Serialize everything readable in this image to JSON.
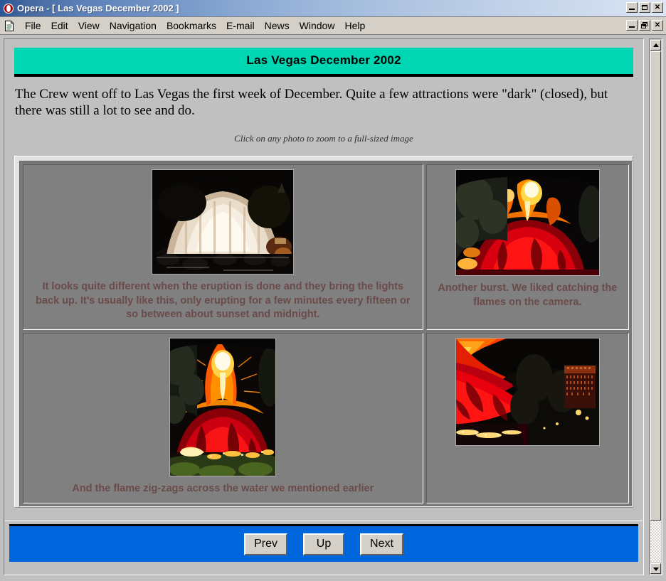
{
  "window": {
    "title": "Opera - [ Las Vegas December 2002 ]",
    "logo_icon": "opera-logo-icon",
    "buttons": {
      "minimize": "minimize-button",
      "maximize": "maximize-button",
      "close": "close-button",
      "mdi_minimize": "mdi-minimize-button",
      "mdi_restore": "mdi-restore-button",
      "mdi_close": "mdi-close-button"
    }
  },
  "menubar": {
    "doc_icon": "document-icon",
    "items": [
      {
        "label": "File"
      },
      {
        "label": "Edit"
      },
      {
        "label": "View"
      },
      {
        "label": "Navigation"
      },
      {
        "label": "Bookmarks"
      },
      {
        "label": "E-mail"
      },
      {
        "label": "News"
      },
      {
        "label": "Window"
      },
      {
        "label": "Help"
      }
    ]
  },
  "page": {
    "header_title": "Las Vegas December 2002",
    "header_background": "#00d6b2",
    "intro": "The Crew went off to Las Vegas the first week of December. Quite a few attractions were \"dark\" (closed), but there was still a lot to see and do.",
    "click_note": "Click on any photo to zoom to a full-sized image",
    "caption_color": "#6b4a4a",
    "cells": [
      {
        "photo_name": "photo-volcano-lights-up",
        "photo_alt": "Waterfall mound lit up white at night after the eruption",
        "caption": "It looks quite different when the eruption is done and they bring the lights back up. It's usually like this, only erupting for a few minutes every fifteen or so between about sunset and midnight."
      },
      {
        "photo_name": "photo-volcano-burst",
        "photo_alt": "Erupting volcano with red lava and a bright orange flame burst",
        "caption": "Another burst. We liked catching the flames on the camera."
      },
      {
        "photo_name": "photo-volcano-tall-flame",
        "photo_alt": "Tall flame column rising above the glowing red volcano",
        "caption": "And the flame zig-zags across the water we mentioned earlier"
      },
      {
        "photo_name": "photo-volcano-with-hotel",
        "photo_alt": "Red glowing volcano with a lit hotel tower in the background",
        "caption": ""
      }
    ]
  },
  "navbar": {
    "background": "#0066dd",
    "buttons": [
      {
        "label": "Prev",
        "name": "prev-button"
      },
      {
        "label": "Up",
        "name": "up-button"
      },
      {
        "label": "Next",
        "name": "next-button"
      }
    ]
  },
  "scrollbar": {
    "up_icon": "scroll-up-arrow-icon",
    "down_icon": "scroll-down-arrow-icon"
  }
}
